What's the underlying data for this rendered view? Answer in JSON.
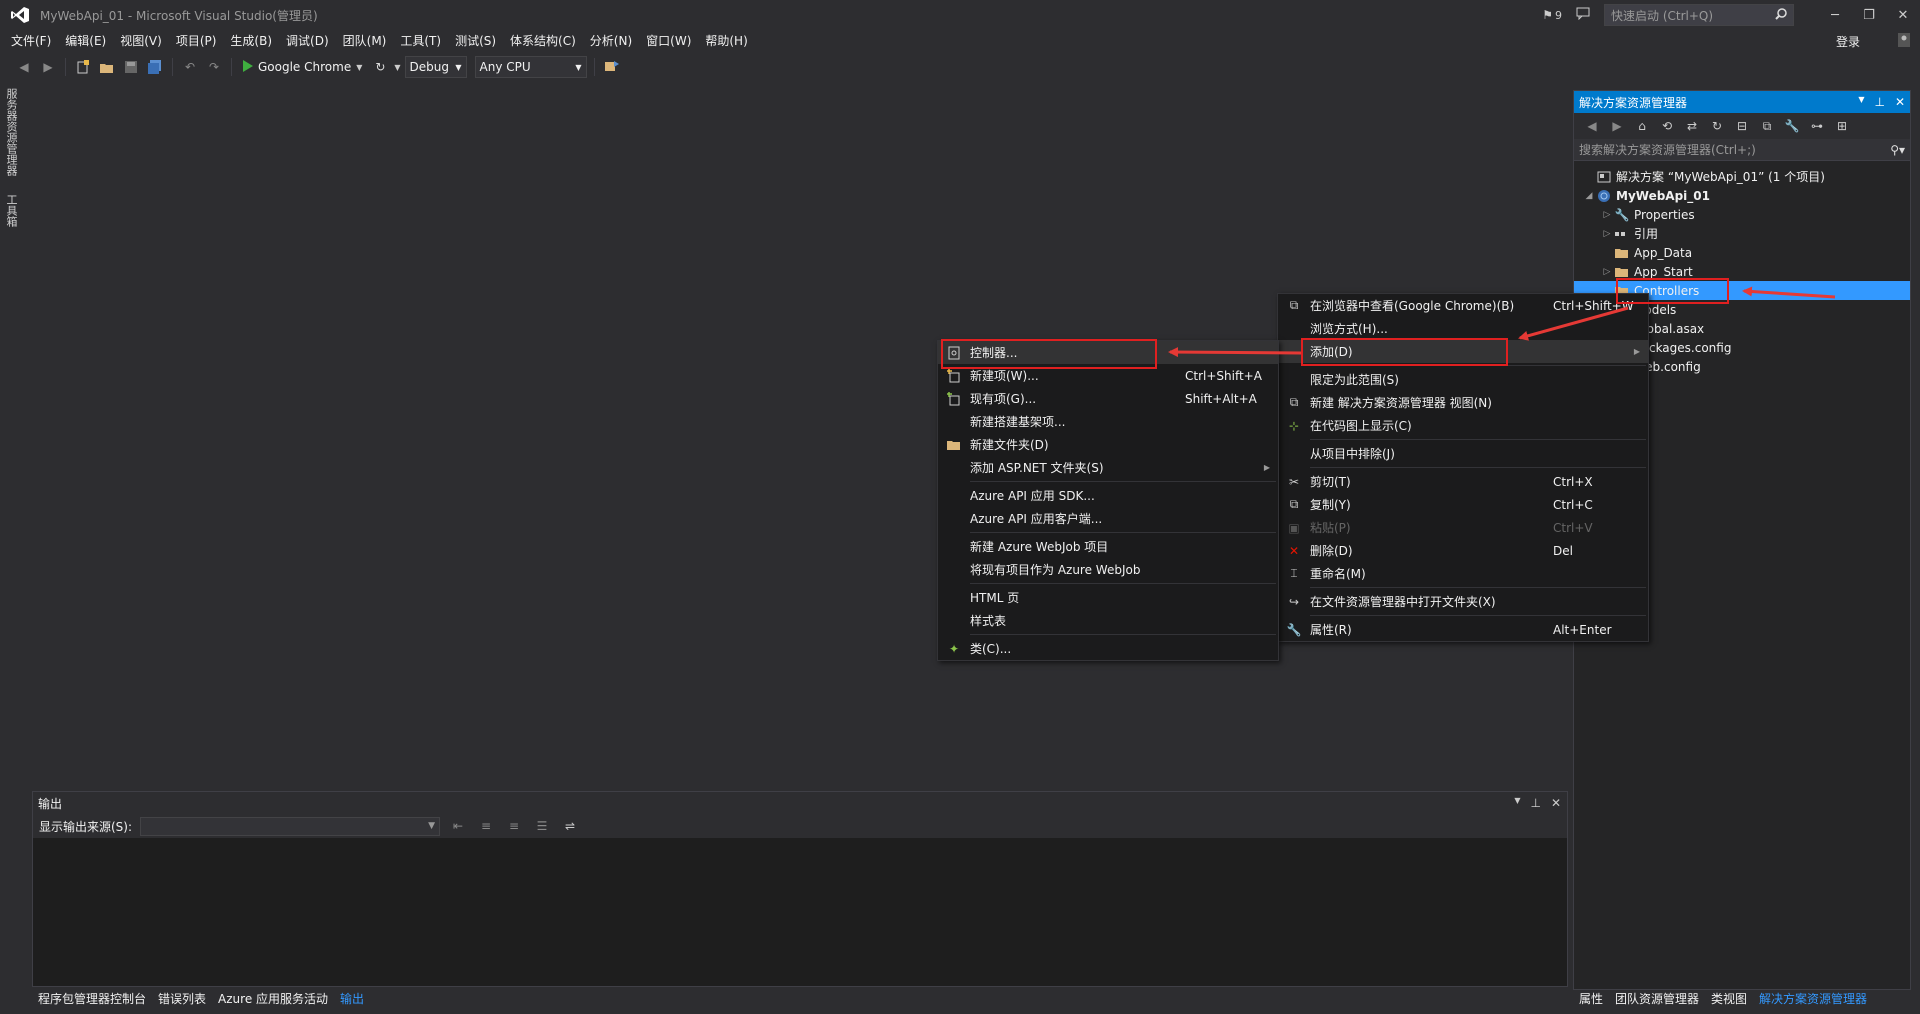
{
  "window": {
    "title": "MyWebApi_01 - Microsoft Visual Studio(管理员)",
    "notification_count": "9",
    "quick_launch_placeholder": "快速启动 (Ctrl+Q)",
    "login": "登录"
  },
  "menu": [
    "文件(F)",
    "编辑(E)",
    "视图(V)",
    "项目(P)",
    "生成(B)",
    "调试(D)",
    "团队(M)",
    "工具(T)",
    "测试(S)",
    "体系结构(C)",
    "分析(N)",
    "窗口(W)",
    "帮助(H)"
  ],
  "toolbar": {
    "run_target": "Google Chrome",
    "config": "Debug",
    "platform": "Any CPU"
  },
  "left_tabs": [
    "服务器资源管理器",
    "工具箱"
  ],
  "solution_explorer": {
    "title": "解决方案资源管理器",
    "search_placeholder": "搜索解决方案资源管理器(Ctrl+;)",
    "items": [
      {
        "label": "解决方案 “MyWebApi_01” (1 个项目)",
        "icon": "solution-icon"
      },
      {
        "label": "MyWebApi_01",
        "icon": "web-project-icon"
      },
      {
        "label": "Properties",
        "icon": "wrench-icon"
      },
      {
        "label": "引用",
        "icon": "references-icon"
      },
      {
        "label": "App_Data",
        "icon": "folder-icon"
      },
      {
        "label": "App_Start",
        "icon": "folder-icon"
      },
      {
        "label": "Controllers",
        "icon": "folder-icon"
      },
      {
        "label": "Models",
        "icon": "folder-icon"
      },
      {
        "label": "Global.asax",
        "icon": "file-icon"
      },
      {
        "label": "packages.config",
        "icon": "file-icon"
      },
      {
        "label": "Web.config",
        "icon": "file-icon"
      }
    ]
  },
  "right_bottom_tabs": [
    "属性",
    "团队资源管理器",
    "类视图",
    "解决方案资源管理器"
  ],
  "output": {
    "title": "输出",
    "source_label": "显示输出来源(S):"
  },
  "bottom_tabs": [
    "程序包管理器控制台",
    "错误列表",
    "Azure 应用服务活动",
    "输出"
  ],
  "context_menu": {
    "items": [
      {
        "label": "在浏览器中查看(Google Chrome)(B)",
        "shortcut": "Ctrl+Shift+W"
      },
      {
        "label": "浏览方式(H)...",
        "shortcut": ""
      },
      {
        "label": "添加(D)",
        "shortcut": ""
      },
      {
        "label": "限定为此范围(S)",
        "shortcut": ""
      },
      {
        "label": "新建 解决方案资源管理器 视图(N)",
        "shortcut": ""
      },
      {
        "label": "在代码图上显示(C)",
        "shortcut": ""
      },
      {
        "label": "从项目中排除(J)",
        "shortcut": ""
      },
      {
        "label": "剪切(T)",
        "shortcut": "Ctrl+X"
      },
      {
        "label": "复制(Y)",
        "shortcut": "Ctrl+C"
      },
      {
        "label": "粘贴(P)",
        "shortcut": "Ctrl+V"
      },
      {
        "label": "删除(D)",
        "shortcut": "Del"
      },
      {
        "label": "重命名(M)",
        "shortcut": ""
      },
      {
        "label": "在文件资源管理器中打开文件夹(X)",
        "shortcut": ""
      },
      {
        "label": "属性(R)",
        "shortcut": "Alt+Enter"
      }
    ]
  },
  "add_submenu": {
    "items": [
      {
        "label": "控制器...",
        "shortcut": ""
      },
      {
        "label": "新建项(W)...",
        "shortcut": "Ctrl+Shift+A"
      },
      {
        "label": "现有项(G)...",
        "shortcut": "Shift+Alt+A"
      },
      {
        "label": "新建搭建基架项...",
        "shortcut": ""
      },
      {
        "label": "新建文件夹(D)",
        "shortcut": ""
      },
      {
        "label": "添加 ASP.NET 文件夹(S)",
        "shortcut": ""
      },
      {
        "label": "Azure API 应用 SDK...",
        "shortcut": ""
      },
      {
        "label": "Azure API 应用客户端...",
        "shortcut": ""
      },
      {
        "label": "新建 Azure WebJob 项目",
        "shortcut": ""
      },
      {
        "label": "将现有项目作为 Azure WebJob",
        "shortcut": ""
      },
      {
        "label": "HTML 页",
        "shortcut": ""
      },
      {
        "label": "样式表",
        "shortcut": ""
      },
      {
        "label": "类(C)...",
        "shortcut": ""
      }
    ]
  },
  "colors": {
    "accent": "#007acc",
    "selection": "#3399ff",
    "highlight_box": "#e02020",
    "folder": "#dcb67a"
  }
}
